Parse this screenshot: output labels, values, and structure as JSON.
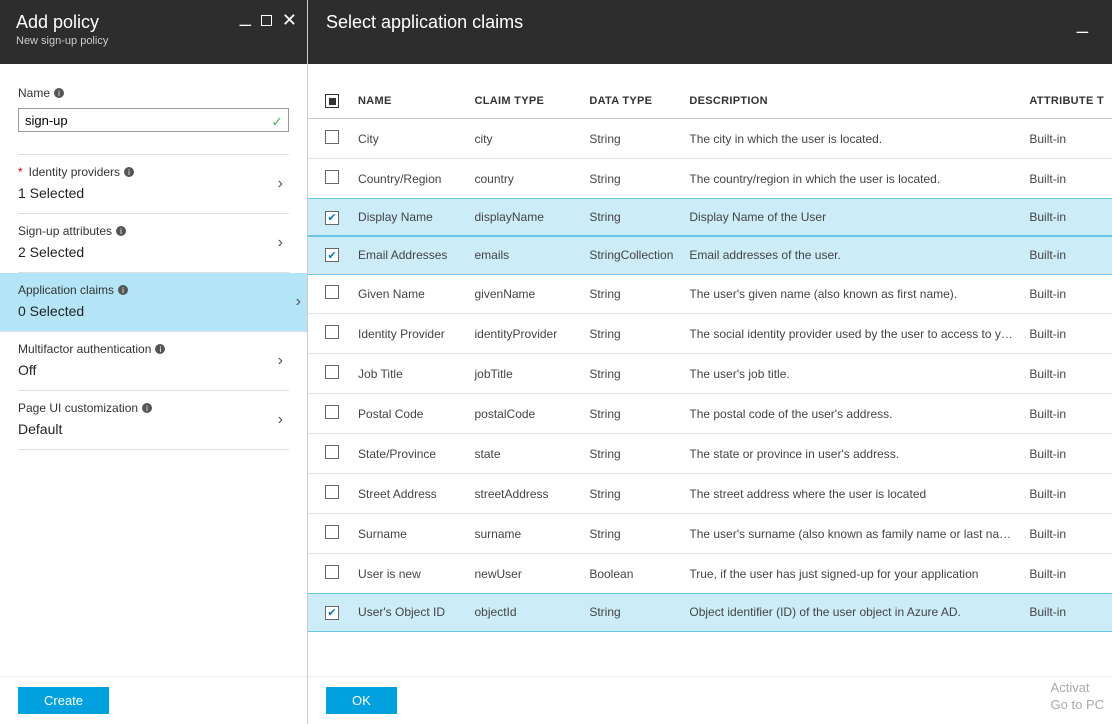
{
  "left": {
    "title": "Add policy",
    "subtitle": "New sign-up policy",
    "nameLabel": "Name",
    "nameValue": "sign-up",
    "sections": [
      {
        "label": "Identity providers",
        "value": "1 Selected",
        "required": true
      },
      {
        "label": "Sign-up attributes",
        "value": "2 Selected",
        "required": false
      },
      {
        "label": "Application claims",
        "value": "0 Selected",
        "required": false,
        "active": true
      },
      {
        "label": "Multifactor authentication",
        "value": "Off",
        "required": false
      },
      {
        "label": "Page UI customization",
        "value": "Default",
        "required": false
      }
    ],
    "createButton": "Create"
  },
  "right": {
    "title": "Select application claims",
    "okButton": "OK",
    "columns": {
      "name": "NAME",
      "claimType": "CLAIM TYPE",
      "dataType": "DATA TYPE",
      "description": "DESCRIPTION",
      "attribute": "ATTRIBUTE T"
    },
    "rows": [
      {
        "selected": false,
        "name": "City",
        "claimType": "city",
        "dataType": "String",
        "description": "The city in which the user is located.",
        "attribute": "Built-in"
      },
      {
        "selected": false,
        "name": "Country/Region",
        "claimType": "country",
        "dataType": "String",
        "description": "The country/region in which the user is located.",
        "attribute": "Built-in"
      },
      {
        "selected": true,
        "name": "Display Name",
        "claimType": "displayName",
        "dataType": "String",
        "description": "Display Name of the User",
        "attribute": "Built-in"
      },
      {
        "selected": true,
        "name": "Email Addresses",
        "claimType": "emails",
        "dataType": "StringCollection",
        "description": "Email addresses of the user.",
        "attribute": "Built-in"
      },
      {
        "selected": false,
        "name": "Given Name",
        "claimType": "givenName",
        "dataType": "String",
        "description": "The user's given name (also known as first name).",
        "attribute": "Built-in"
      },
      {
        "selected": false,
        "name": "Identity Provider",
        "claimType": "identityProvider",
        "dataType": "String",
        "description": "The social identity provider used by the user to access to your ap...",
        "attribute": "Built-in"
      },
      {
        "selected": false,
        "name": "Job Title",
        "claimType": "jobTitle",
        "dataType": "String",
        "description": "The user's job title.",
        "attribute": "Built-in"
      },
      {
        "selected": false,
        "name": "Postal Code",
        "claimType": "postalCode",
        "dataType": "String",
        "description": "The postal code of the user's address.",
        "attribute": "Built-in"
      },
      {
        "selected": false,
        "name": "State/Province",
        "claimType": "state",
        "dataType": "String",
        "description": "The state or province in user's address.",
        "attribute": "Built-in"
      },
      {
        "selected": false,
        "name": "Street Address",
        "claimType": "streetAddress",
        "dataType": "String",
        "description": "The street address where the user is located",
        "attribute": "Built-in"
      },
      {
        "selected": false,
        "name": "Surname",
        "claimType": "surname",
        "dataType": "String",
        "description": "The user's surname (also known as family name or last name).",
        "attribute": "Built-in"
      },
      {
        "selected": false,
        "name": "User is new",
        "claimType": "newUser",
        "dataType": "Boolean",
        "description": "True, if the user has just signed-up for your application",
        "attribute": "Built-in"
      },
      {
        "selected": true,
        "name": "User's Object ID",
        "claimType": "objectId",
        "dataType": "String",
        "description": "Object identifier (ID) of the user object in Azure AD.",
        "attribute": "Built-in"
      }
    ]
  },
  "watermark": {
    "line1": "Activat",
    "line2": "Go to PC"
  }
}
